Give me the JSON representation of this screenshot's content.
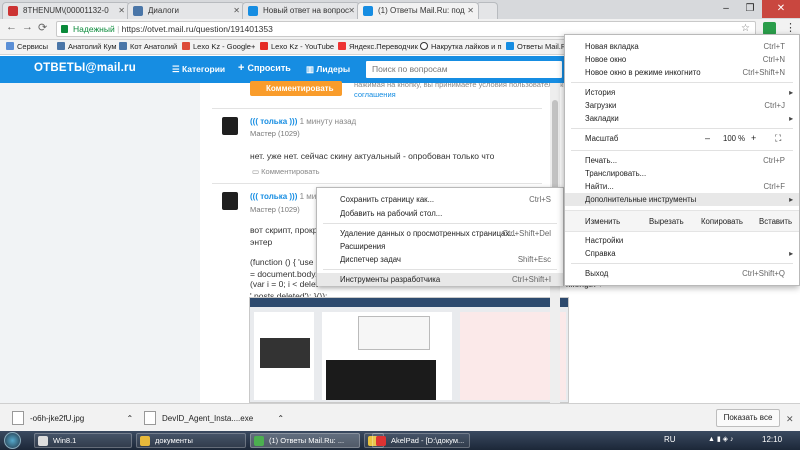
{
  "browser": {
    "tabs": [
      {
        "title": "8THENUM\\(00001132-0",
        "color": "#c33"
      },
      {
        "title": "Диалоги",
        "color": "#4a76a8"
      },
      {
        "title": "Новый ответ на вопрос",
        "color": "#168de2"
      },
      {
        "title": "(1) Ответы Mail.Ru: под",
        "color": "#168de2"
      }
    ],
    "window_controls": {
      "minimize": "–",
      "maximize": "❐",
      "close": "✕"
    },
    "nav": {
      "back": "←",
      "forward": "→",
      "reload": "⟳"
    },
    "address": {
      "secure_label": "Надежный",
      "url": "https://otvet.mail.ru/question/191401353",
      "star": "☆"
    },
    "bookmarks": [
      {
        "label": "Сервисы",
        "color": "#5b8fd6"
      },
      {
        "label": "Анатолий Кум",
        "color": "#4a76a8"
      },
      {
        "label": "Кот Анатолий",
        "color": "#4a76a8"
      },
      {
        "label": "Lexo Kz - Google+",
        "color": "#dd4b39"
      },
      {
        "label": "Lexo Kz - YouTube",
        "color": "#e52d27"
      },
      {
        "label": "Яндекс.Переводчик",
        "color": "#e33"
      },
      {
        "label": "Накрутка лайков и п",
        "color": "#333"
      },
      {
        "label": "Ответы Mail.R",
        "color": "#168de2"
      }
    ]
  },
  "site": {
    "logo": "ОТВЕТЫ@mail.ru",
    "nav": [
      "Категории",
      "Спросить",
      "Лидеры"
    ],
    "search_placeholder": "Поиск по вопросам",
    "comment_button": "Комментировать",
    "agreement_text": "соглашения",
    "agreement_top": "нажимая на кнопку, вы принимаете условия пользовательского",
    "answers": [
      {
        "user": "((( толька )))",
        "time": "1 минуту назад",
        "rank": "Мастер (1029)",
        "text": "нет. уже нет. сейчас скину актуальный - опробован только что",
        "comment": "Комментировать"
      },
      {
        "user": "((( толька )))",
        "time": "1 минуту назад",
        "rank": "Мастер (1029)",
        "line1": "вот скрипт, прокру",
        "line2": "энтер",
        "code1": "(function () { 'use s",
        "code2": "= document.body.",
        "code3": "(var i = 0; i < delet",
        "code_right": "k.length +",
        "code4": "' posts deleted'); }());"
      }
    ]
  },
  "context_menu": {
    "items": [
      {
        "label": "Сохранить страницу как...",
        "key": "Ctrl+S"
      },
      {
        "label": "Добавить на рабочий стол...",
        "key": ""
      },
      {
        "label": "Удаление данных о просмотренных страницах...",
        "key": "Ctrl+Shift+Del"
      },
      {
        "label": "Расширения",
        "key": ""
      },
      {
        "label": "Диспетчер задач",
        "key": "Shift+Esc"
      },
      {
        "label": "Инструменты разработчика",
        "key": "Ctrl+Shift+I"
      }
    ]
  },
  "chrome_menu": {
    "new_tab": {
      "label": "Новая вкладка",
      "key": "Ctrl+T"
    },
    "new_window": {
      "label": "Новое окно",
      "key": "Ctrl+N"
    },
    "incognito": {
      "label": "Новое окно в режиме инкогнито",
      "key": "Ctrl+Shift+N"
    },
    "history": {
      "label": "История"
    },
    "downloads": {
      "label": "Загрузки",
      "key": "Ctrl+J"
    },
    "bookmarks": {
      "label": "Закладки"
    },
    "zoom": {
      "label": "Масштаб",
      "minus": "–",
      "value": "100 %",
      "plus": "+",
      "fullscreen": "⛶"
    },
    "print": {
      "label": "Печать...",
      "key": "Ctrl+P"
    },
    "cast": {
      "label": "Транслировать..."
    },
    "find": {
      "label": "Найти...",
      "key": "Ctrl+F"
    },
    "more_tools": {
      "label": "Дополнительные инструменты"
    },
    "edit": {
      "label": "Изменить",
      "cut": "Вырезать",
      "copy": "Копировать",
      "paste": "Вставить"
    },
    "settings": {
      "label": "Настройки"
    },
    "help": {
      "label": "Справка"
    },
    "exit": {
      "label": "Выход",
      "key": "Ctrl+Shift+Q"
    }
  },
  "downloads": {
    "items": [
      {
        "name": "-o6h-jke2fU.jpg"
      },
      {
        "name": "DevID_Agent_Insta....exe"
      }
    ],
    "show_all": "Показать все",
    "close": "✕"
  },
  "taskbar": {
    "items": [
      {
        "label": "Win8.1",
        "color": "#ddd"
      },
      {
        "label": "документы",
        "color": "#e7b93b"
      },
      {
        "label": "(1) Ответы Mail.Ru: ...",
        "color": "#4caf50"
      },
      {
        "label": "",
        "color": "#e9c341"
      },
      {
        "label": "AkelPad - [D:\\докум...",
        "color": "#d33"
      }
    ],
    "lang": "RU",
    "time": "12:10"
  },
  "colors": {
    "site_blue": "#168de2",
    "accent_orange": "#f99c2b"
  }
}
